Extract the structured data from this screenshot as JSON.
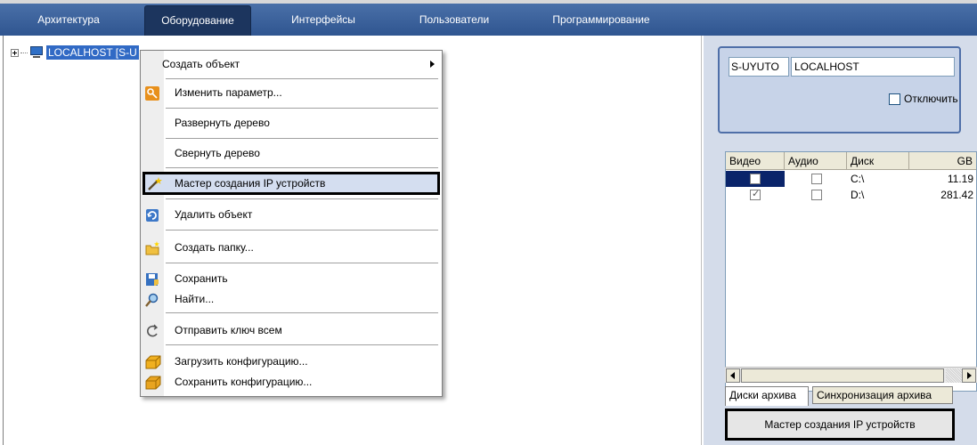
{
  "tabs": [
    {
      "label": "Архитектура"
    },
    {
      "label": "Оборудование"
    },
    {
      "label": "Интерфейсы"
    },
    {
      "label": "Пользователи"
    },
    {
      "label": "Программирование"
    }
  ],
  "tree": {
    "root_label": "LOCALHOST [S-U"
  },
  "context_menu": {
    "items": [
      {
        "label": "Создать объект"
      },
      {
        "label": "Изменить параметр..."
      },
      {
        "label": "Развернуть дерево"
      },
      {
        "label": "Свернуть дерево"
      },
      {
        "label": "Мастер создания IP устройств"
      },
      {
        "label": "Удалить объект"
      },
      {
        "label": "Создать папку..."
      },
      {
        "label": "Сохранить"
      },
      {
        "label": "Найти..."
      },
      {
        "label": "Отправить ключ всем"
      },
      {
        "label": "Загрузить конфигурацию..."
      },
      {
        "label": "Сохранить конфигурацию..."
      }
    ]
  },
  "host": {
    "id": "S-UYUTO",
    "name": "LOCALHOST",
    "disable_label": "Отключить"
  },
  "disks": {
    "columns": [
      "Видео",
      "Аудио",
      "Диск",
      "GB"
    ],
    "rows": [
      {
        "video": false,
        "audio": false,
        "disk": "C:\\",
        "gb": "11.19"
      },
      {
        "video": true,
        "audio": false,
        "disk": "D:\\",
        "gb": "281.42"
      }
    ]
  },
  "bottom_tabs": [
    {
      "label": "Диски архива"
    },
    {
      "label": "Синхронизация архива"
    }
  ],
  "wizard_button": "Мастер создания IP устройств",
  "colors": {
    "tabbar": "#3a5f96",
    "selection": "#316ac5",
    "panel": "#d4dcea"
  }
}
